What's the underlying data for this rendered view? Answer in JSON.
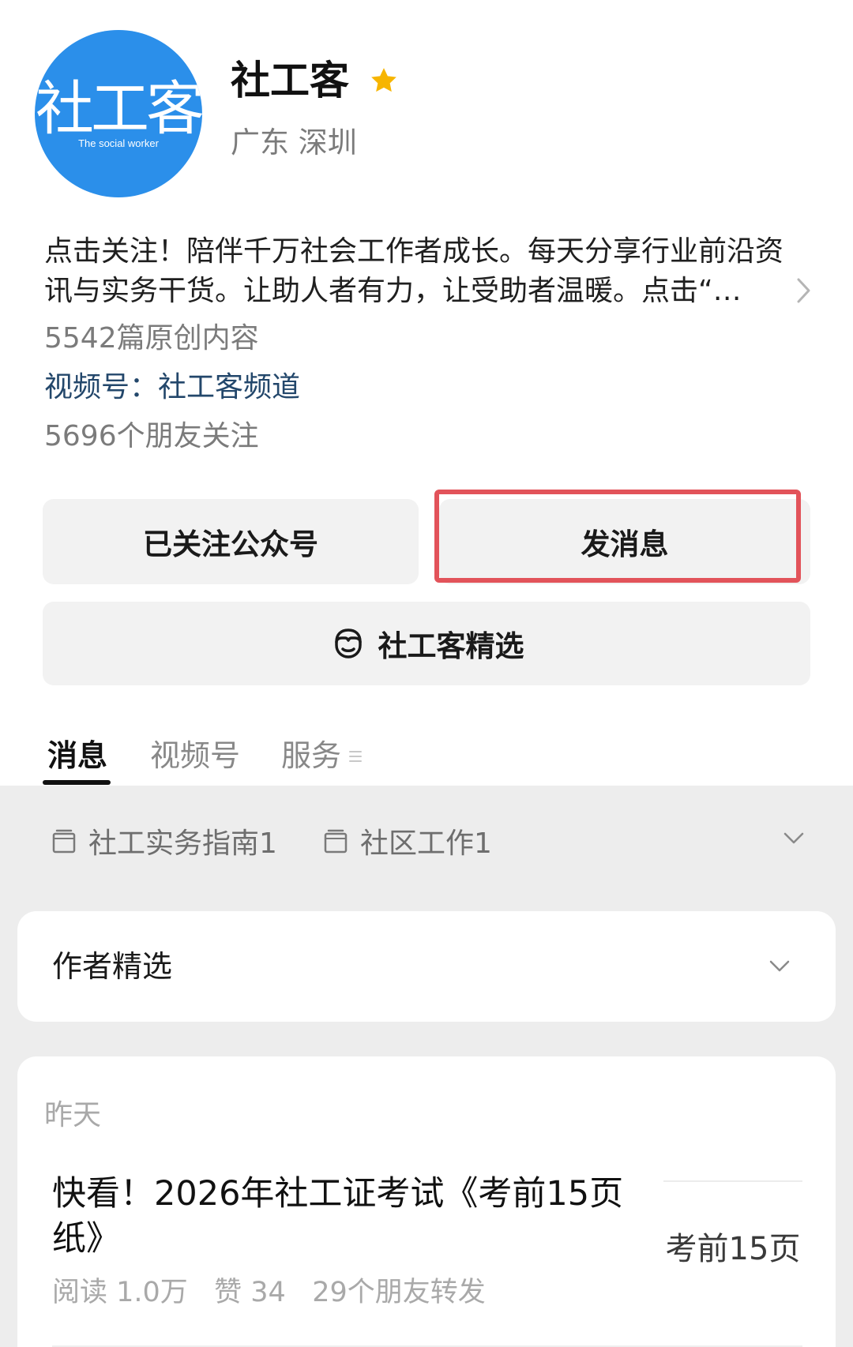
{
  "profile": {
    "avatar_logo_text": "社工客",
    "avatar_logo_subtext": "The social worker",
    "name": "社工客",
    "region": "广东 深圳",
    "bio": "点击关注！陪伴千万社会工作者成长。每天分享行业前沿资讯与实务干货。让助人者有力，让受助者温暖。点击“…",
    "original_count": "5542篇原创内容",
    "channel_link": "视频号：社工客频道",
    "friends_following": "5696个朋友关注"
  },
  "actions": {
    "followed_label": "已关注公众号",
    "message_label": "发消息",
    "featured_label": "社工客精选"
  },
  "tabs": [
    {
      "label": "消息"
    },
    {
      "label": "视频号"
    },
    {
      "label": "服务"
    }
  ],
  "collections": [
    {
      "label": "社工实务指南1"
    },
    {
      "label": "社区工作1"
    }
  ],
  "author_section": {
    "title": "作者精选"
  },
  "article": {
    "date": "昨天",
    "title": "快看！2026年社工证考试《考前15页纸》",
    "stats": "阅读 1.0万   赞 34   29个朋友转发",
    "thumbnail_text": "考前15页"
  },
  "colors": {
    "brand_blue": "#2b8fea",
    "star": "#f7b500",
    "highlight_border": "#e2535a",
    "link": "#23476b"
  },
  "icons": {
    "star": "star-icon",
    "featured": "mini-program-icon",
    "collection": "folder-icon",
    "chevron": "chevron-down-icon",
    "bio_more": "chevron-right-icon",
    "tab_menu": "menu-lines-icon"
  }
}
